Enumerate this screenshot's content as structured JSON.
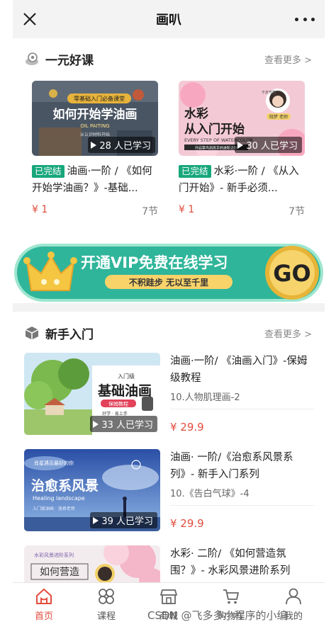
{
  "header": {
    "title": "画叭"
  },
  "section1": {
    "title": "一元好课",
    "more": "查看更多 >",
    "courses": [
      {
        "thumb_line1": "零基础入门必备课堂",
        "thumb_line2": "如何开始学油画",
        "thumb_line3": "OIL PAITING",
        "thumb_line4": "从认识材料开始",
        "learners": "28 人已学习",
        "status": "已完结",
        "title": "油画·一阶 / 《如何开始学油画？》-基础...",
        "price": "¥ 1",
        "lessons": "7节"
      },
      {
        "thumb_line1": "水彩",
        "thumb_line2": "从入门开始",
        "thumb_line3": "EVERY STEP OF WATERCOLOR",
        "thumb_line4": "开启菜鸟到高手的进阶之路",
        "thumb_tag": "晓梦 老师",
        "thumb_side": "不走弯路",
        "learners": "30 人已学习",
        "status": "已完结",
        "title": "水彩·一阶 / 《从入门开始》- 新手必须...",
        "price": "¥ 1",
        "lessons": "7节"
      }
    ]
  },
  "vip": {
    "headline": "开通VIP免费在线学习",
    "slogan": "不积跬步  无以至千里",
    "go": "GO"
  },
  "section2": {
    "title": "新手入门",
    "more": "查看更多 >",
    "items": [
      {
        "thumb_tag": "入门级",
        "thumb_title": "基础油画",
        "thumb_sub": "保姆教程",
        "thumb_note": "好学 · 易上手",
        "learners": "33 人已学习",
        "title": "油画·一阶/ 《油画入门》-保姆级教程",
        "sub": "10.人物肌理画-2",
        "price": "¥ 29.9"
      },
      {
        "thumb_tag": "肖星遇见最好的你",
        "thumb_title": "治愈系风景",
        "thumb_sub": "Healing landscape",
        "thumb_note": "入门级油画  ·  洛君老师",
        "learners": "39 人已学习",
        "title": "油画· 一阶/《治愈系风景系列》- 新手入门系列",
        "sub": "10.《告白气球》-4",
        "price": "¥ 29.9"
      },
      {
        "thumb_tag": "水彩风景进阶系列",
        "thumb_title": "如何营造",
        "title": "水彩· 二阶/ 《如何营造氛围？》- 水彩风景进阶系列"
      }
    ]
  },
  "nav": [
    {
      "label": "首页"
    },
    {
      "label": "课程"
    },
    {
      "label": "商城"
    },
    {
      "label": "购物车"
    },
    {
      "label": "我的"
    }
  ],
  "watermark": "CSDN @飞多多小程序的小编",
  "colors": {
    "accent": "#e24c3e",
    "done": "#18a77b",
    "vip_bg": "#2fb59a",
    "vip_gold": "#f5c642"
  }
}
